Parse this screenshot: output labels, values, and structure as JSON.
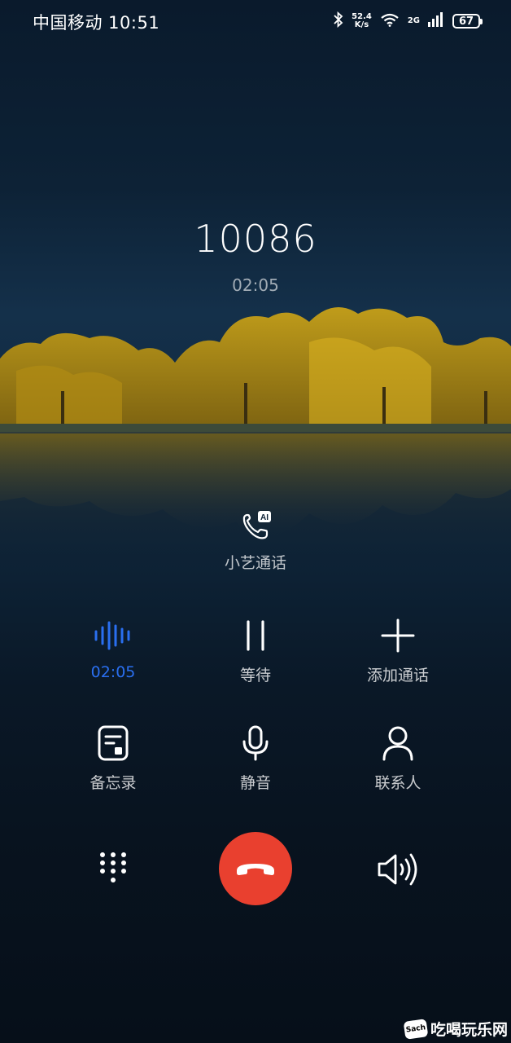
{
  "status_bar": {
    "carrier_time": "中国移动 10:51",
    "net_speed_value": "52.4",
    "net_speed_unit": "K/s",
    "signal_gen": "2G",
    "battery": "67"
  },
  "call": {
    "number": "10086",
    "duration": "02:05"
  },
  "xiaoyi": {
    "label": "小艺通话",
    "badge": "AI"
  },
  "controls": {
    "recording_time": "02:05",
    "hold": "等待",
    "add_call": "添加通话",
    "memo": "备忘录",
    "mute": "静音",
    "contacts": "联系人"
  },
  "colors": {
    "end_call": "#e9402f",
    "active_blue": "#2a6ff0"
  },
  "watermark": {
    "badge": "Sach",
    "text": "吃喝玩乐网"
  }
}
